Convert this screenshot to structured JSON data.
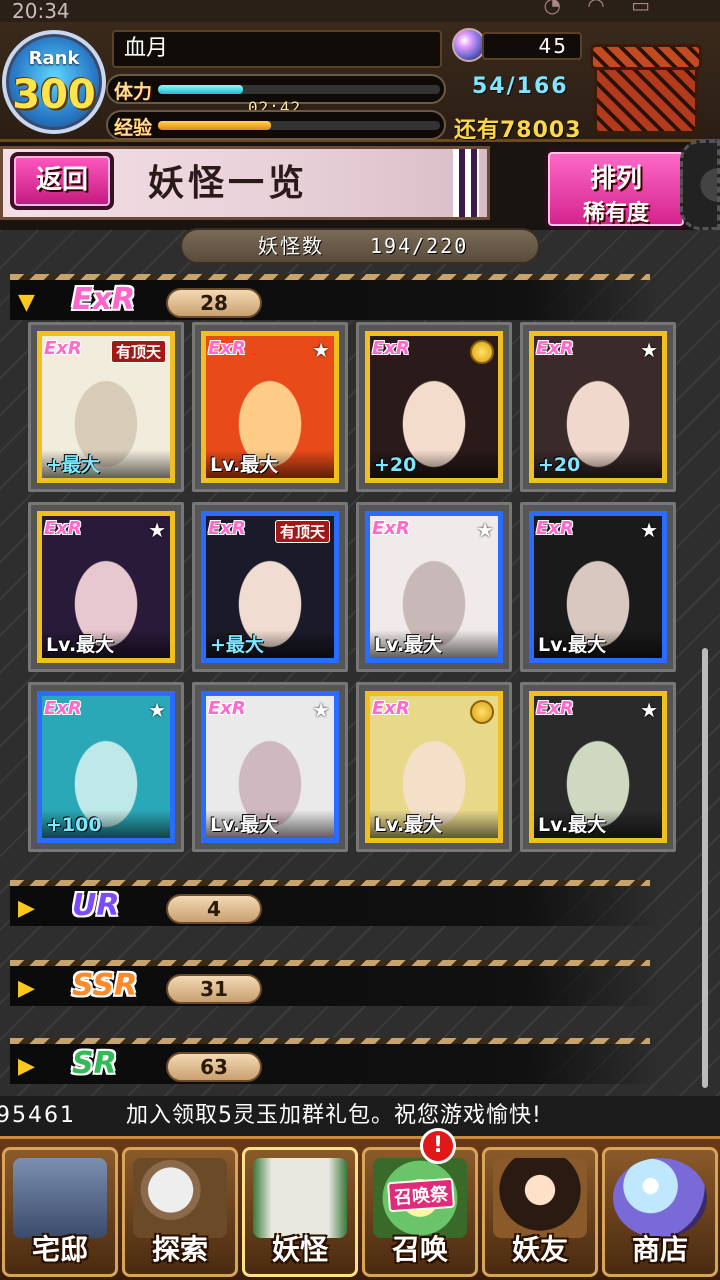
{
  "status_bar": {
    "time": "20:34"
  },
  "header": {
    "rank_label": "Rank",
    "rank_value": "300",
    "player_name": "血月",
    "stamina_label": "体力",
    "stamina_timer": "02:42",
    "stamina_fill_fraction": 0.3,
    "exp_label": "经验",
    "exp_fill_fraction": 0.4,
    "orb_count": "45",
    "stamina_value": "54/166",
    "gold_text": "还有78003"
  },
  "title_bar": {
    "back_label": "返回",
    "page_title": "妖怪一览",
    "sort_label_1": "排列",
    "sort_label_2": "稀有度"
  },
  "count": {
    "label": "妖怪数",
    "value": "194/220"
  },
  "sections": [
    {
      "rarity": "ExR",
      "count": "28",
      "expanded": true
    },
    {
      "rarity": "UR",
      "count": "4",
      "expanded": false
    },
    {
      "rarity": "SSR",
      "count": "31",
      "expanded": false
    },
    {
      "rarity": "SR",
      "count": "63",
      "expanded": false
    }
  ],
  "cards": [
    {
      "tag": "ExR",
      "badge": "有顶天",
      "level": "+最大",
      "frame": "gold"
    },
    {
      "tag": "ExR",
      "badge": "★",
      "level": "Lv.最大",
      "frame": "gold"
    },
    {
      "tag": "ExR",
      "badge": "medal",
      "level": "+20",
      "frame": "gold"
    },
    {
      "tag": "ExR",
      "badge": "★",
      "level": "+20",
      "frame": "gold"
    },
    {
      "tag": "ExR",
      "badge": "★",
      "level": "Lv.最大",
      "frame": "gold"
    },
    {
      "tag": "ExR",
      "badge": "有顶天",
      "level": "+最大",
      "frame": "blue"
    },
    {
      "tag": "ExR",
      "badge": "★",
      "level": "Lv.最大",
      "frame": "blue"
    },
    {
      "tag": "ExR",
      "badge": "★",
      "level": "Lv.最大",
      "frame": "blue"
    },
    {
      "tag": "ExR",
      "badge": "★",
      "level": "+100",
      "frame": "blue"
    },
    {
      "tag": "ExR",
      "badge": "★",
      "level": "Lv.最大",
      "frame": "blue"
    },
    {
      "tag": "ExR",
      "badge": "medal",
      "level": "Lv.最大",
      "frame": "gold"
    },
    {
      "tag": "ExR",
      "badge": "★",
      "level": "Lv.最大",
      "frame": "gold"
    }
  ],
  "ticker": {
    "prefix": "95461",
    "message": "加入领取5灵玉加群礼包。祝您游戏愉快!"
  },
  "nav": {
    "home": "宅邸",
    "explore": "探索",
    "yokai": "妖怪",
    "summon": "召唤",
    "summon_fest": "召唤祭",
    "alert": "!",
    "friends": "妖友",
    "shop": "商店"
  },
  "colors": {
    "pink_accent": "#d2228c",
    "gold": "#ffd84a",
    "cyan": "#7fe6ff"
  }
}
